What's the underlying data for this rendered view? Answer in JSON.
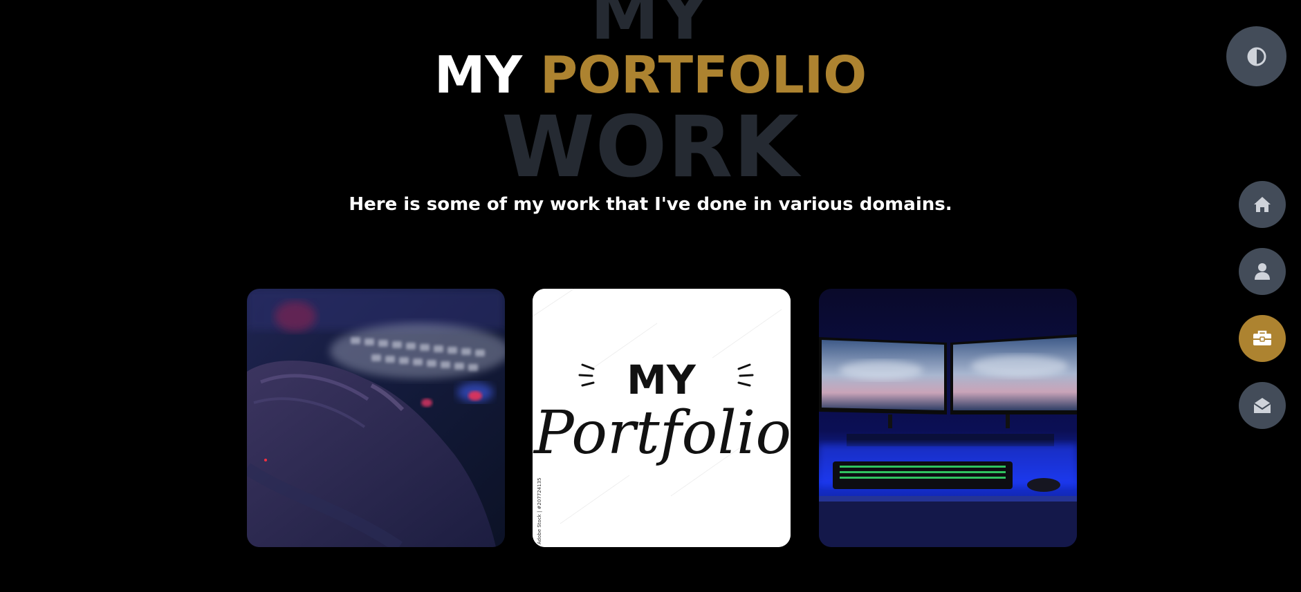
{
  "hero": {
    "bg_word_top": "MY",
    "title_white": "MY",
    "title_accent": "PORTFOLIO",
    "bg_word_bottom": "WORK",
    "subtitle": "Here is some of my work that I've done in various domains."
  },
  "portfolio": {
    "items": [
      {
        "name": "hand-on-keyboard-photo"
      },
      {
        "name": "my-portfolio-lettering-image",
        "line1": "MY",
        "line2": "Portfolio",
        "watermark": "Adobe Stock | #207724135"
      },
      {
        "name": "dual-monitor-setup-photo"
      }
    ]
  },
  "sidebar": {
    "theme_toggle_icon": "contrast-icon",
    "nav": [
      {
        "id": "home",
        "icon": "home-icon",
        "active": false
      },
      {
        "id": "about",
        "icon": "user-icon",
        "active": false
      },
      {
        "id": "portfolio",
        "icon": "briefcase-icon",
        "active": true
      },
      {
        "id": "contact",
        "icon": "envelope-open-icon",
        "active": false
      }
    ]
  },
  "colors": {
    "background": "#000000",
    "accent": "#ad8330",
    "button_bg": "#434c59",
    "bg_word": "#252a32",
    "text": "#ffffff"
  }
}
